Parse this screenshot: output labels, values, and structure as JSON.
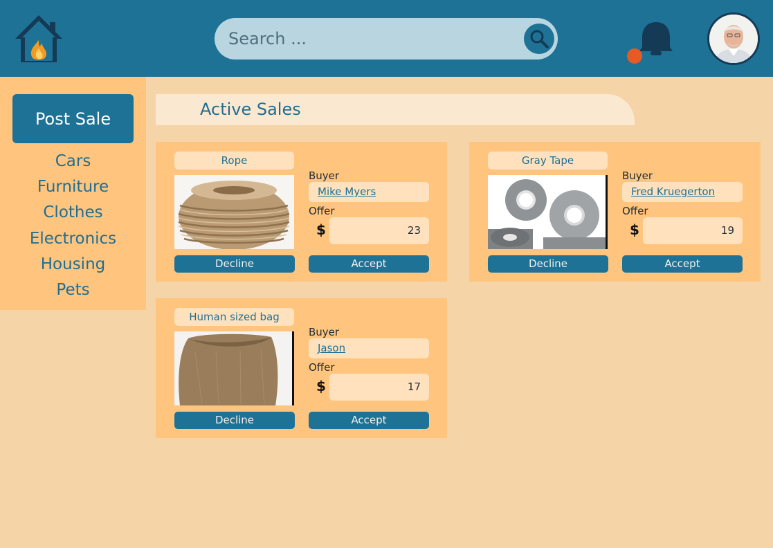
{
  "header": {
    "search_placeholder": "Search ...",
    "icons": {
      "logo": "house-fire-icon",
      "search": "search-icon",
      "notifications": "bell-icon",
      "avatar": "user-avatar"
    },
    "notification_dot_color": "#e85a24"
  },
  "sidebar": {
    "post_sale_label": "Post Sale",
    "categories": [
      "Cars",
      "Furniture",
      "Clothes",
      "Electronics",
      "Housing",
      "Pets"
    ]
  },
  "main": {
    "section_title": "Active Sales",
    "sales": [
      {
        "item": "Rope",
        "buyer_label": "Buyer",
        "buyer": "Mike Myers",
        "offer_label": "Offer",
        "currency": "$",
        "offer": "23",
        "decline_label": "Decline",
        "accept_label": "Accept"
      },
      {
        "item": "Gray Tape",
        "buyer_label": "Buyer",
        "buyer": "Fred Kruegerton",
        "offer_label": "Offer",
        "currency": "$",
        "offer": "19",
        "decline_label": "Decline",
        "accept_label": "Accept"
      },
      {
        "item": "Human sized bag",
        "buyer_label": "Buyer",
        "buyer": "Jason",
        "offer_label": "Offer",
        "currency": "$",
        "offer": "17",
        "decline_label": "Decline",
        "accept_label": "Accept"
      }
    ]
  },
  "colors": {
    "header": "#1e7296",
    "background": "#f5d4a8",
    "card": "#ffc47e",
    "accent": "#1e6f93"
  }
}
